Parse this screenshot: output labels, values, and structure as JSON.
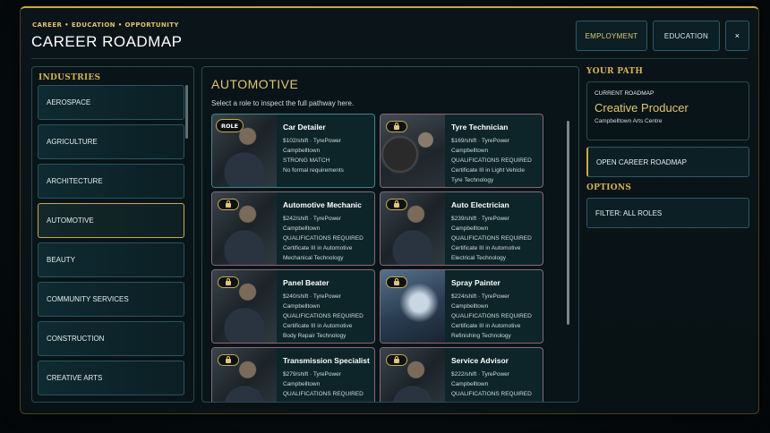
{
  "header": {
    "breadcrumb": "CAREER • EDUCATION • OPPORTUNITY",
    "title": "CAREER ROADMAP",
    "employment_label": "EMPLOYMENT",
    "education_label": "EDUCATION",
    "close_label": "×"
  },
  "industries": {
    "heading": "INDUSTRIES",
    "items": [
      {
        "label": "AEROSPACE"
      },
      {
        "label": "AGRICULTURE"
      },
      {
        "label": "ARCHITECTURE"
      },
      {
        "label": "AUTOMOTIVE"
      },
      {
        "label": "BEAUTY"
      },
      {
        "label": "COMMUNITY SERVICES"
      },
      {
        "label": "CONSTRUCTION"
      },
      {
        "label": "CREATIVE ARTS"
      }
    ],
    "active": "AUTOMOTIVE"
  },
  "main": {
    "title": "AUTOMOTIVE",
    "subtitle": "Select a role to inspect the full pathway here.",
    "roles": [
      {
        "title": "Car Detailer",
        "pay": "$102/shift",
        "employer": "TyrePower",
        "location": "Campbelltown",
        "status": "STRONG MATCH",
        "req1": "No formal requirements",
        "req2": "",
        "badge": "ROLE"
      },
      {
        "title": "Tyre Technician",
        "pay": "$169/shift",
        "employer": "TyrePower",
        "location": "Campbelltown",
        "status": "QUALIFICATIONS REQUIRED",
        "req1": "Certificate III in Light Vehicle",
        "req2": "Tyre Technology",
        "badge": "lock"
      },
      {
        "title": "Automotive Mechanic",
        "pay": "$242/shift",
        "employer": "TyrePower",
        "location": "Campbelltown",
        "status": "QUALIFICATIONS REQUIRED",
        "req1": "Certificate III in Automotive",
        "req2": "Mechanical Technology",
        "badge": "lock"
      },
      {
        "title": "Auto Electrician",
        "pay": "$239/shift",
        "employer": "TyrePower",
        "location": "Campbelltown",
        "status": "QUALIFICATIONS REQUIRED",
        "req1": "Certificate III in Automotive",
        "req2": "Electrical Technology",
        "badge": "lock"
      },
      {
        "title": "Panel Beater",
        "pay": "$240/shift",
        "employer": "TyrePower",
        "location": "Campbelltown",
        "status": "QUALIFICATIONS REQUIRED",
        "req1": "Certificate III in Automotive",
        "req2": "Body Repair Technology",
        "badge": "lock"
      },
      {
        "title": "Spray Painter",
        "pay": "$224/shift",
        "employer": "TyrePower",
        "location": "Campbelltown",
        "status": "QUALIFICATIONS REQUIRED",
        "req1": "Certificate III in Automotive",
        "req2": "Refinishing Technology",
        "badge": "lock"
      },
      {
        "title": "Transmission Specialist",
        "pay": "$279/shift",
        "employer": "TyrePower",
        "location": "Campbelltown",
        "status": "QUALIFICATIONS REQUIRED",
        "req1": "",
        "req2": "",
        "badge": "lock"
      },
      {
        "title": "Service Advisor",
        "pay": "$222/shift",
        "employer": "TyrePower",
        "location": "Campbelltown",
        "status": "QUALIFICATIONS REQUIRED",
        "req1": "",
        "req2": "",
        "badge": "lock"
      }
    ]
  },
  "path": {
    "heading": "YOUR PATH",
    "current_label": "CURRENT ROADMAP",
    "current_value": "Creative Producer",
    "current_sub": "Campbelltown Arts Centre",
    "open_label": "OPEN CAREER ROADMAP"
  },
  "options": {
    "heading": "OPTIONS",
    "filter_label": "FILTER: ALL ROLES"
  },
  "colors": {
    "accent": "#c9a84a",
    "panel": "#081417",
    "border": "#2a5a66"
  }
}
